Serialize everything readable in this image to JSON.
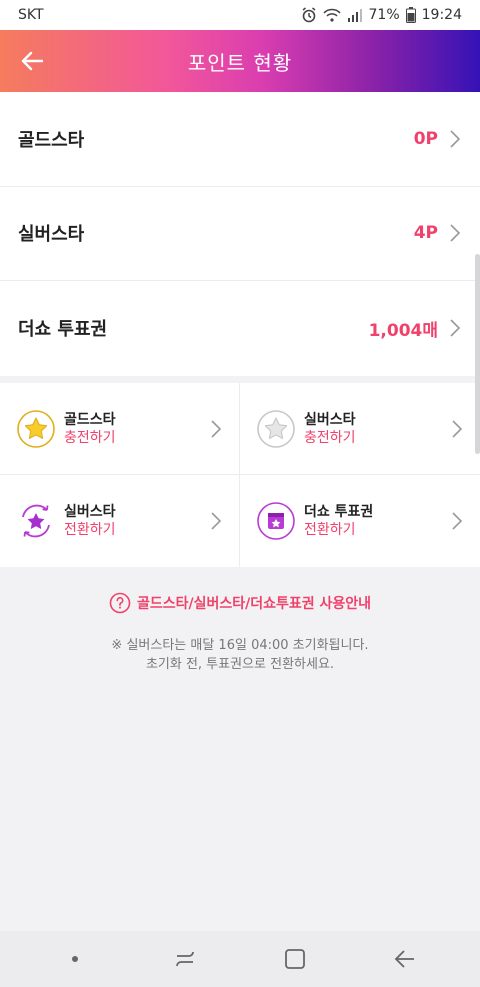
{
  "status": {
    "carrier": "SKT",
    "battery": "71%",
    "time": "19:24"
  },
  "header": {
    "title": "포인트 현황"
  },
  "points": [
    {
      "label": "골드스타",
      "value": "0P"
    },
    {
      "label": "실버스타",
      "value": "4P"
    },
    {
      "label": "더쇼 투표권",
      "value": "1,004매"
    }
  ],
  "actions": [
    {
      "title": "골드스타",
      "sub": "충전하기",
      "icon": "gold-star-icon"
    },
    {
      "title": "실버스타",
      "sub": "충전하기",
      "icon": "silver-star-icon"
    },
    {
      "title": "실버스타",
      "sub": "전환하기",
      "icon": "star-convert-icon"
    },
    {
      "title": "더쇼 투표권",
      "sub": "전환하기",
      "icon": "ticket-convert-icon"
    }
  ],
  "guide": {
    "text": "골드스타/실버스타/더쇼투표권 사용안내"
  },
  "notice": {
    "line1": "※ 실버스타는 매달 16일 04:00 초기화됩니다.",
    "line2": "초기화 전, 투표권으로 전환하세요."
  },
  "colors": {
    "accent": "#f0416a",
    "gold": "#e9b321",
    "purple": "#b93bd6"
  }
}
